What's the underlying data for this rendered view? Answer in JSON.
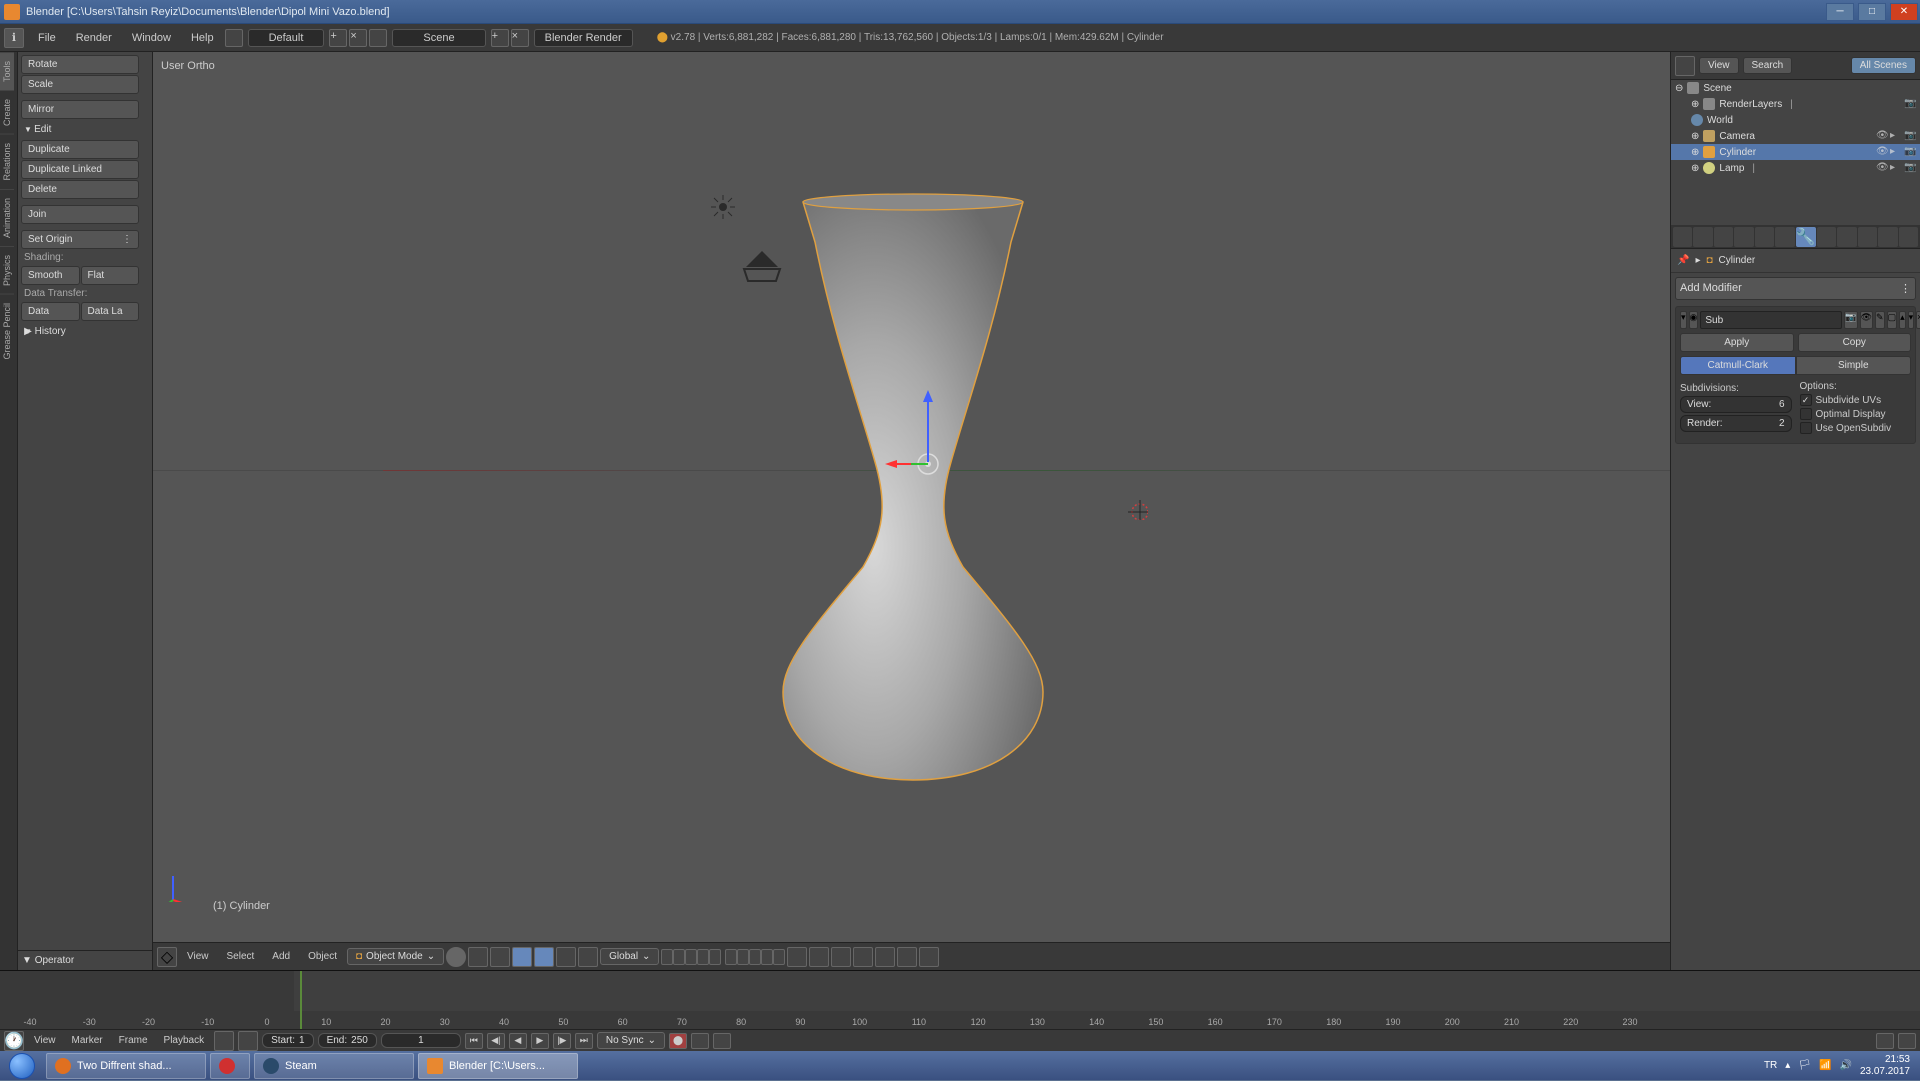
{
  "window": {
    "title": "Blender [C:\\Users\\Tahsin Reyiz\\Documents\\Blender\\Dipol Mini Vazo.blend]"
  },
  "info_header": {
    "menus": [
      "File",
      "Render",
      "Window",
      "Help"
    ],
    "layout": "Default",
    "scene": "Scene",
    "engine": "Blender Render",
    "stats": "v2.78 | Verts:6,881,282 | Faces:6,881,280 | Tris:13,762,560 | Objects:1/3 | Lamps:0/1 | Mem:429.62M | Cylinder"
  },
  "tool_tabs": [
    "Tools",
    "Create",
    "Relations",
    "Animation",
    "Physics",
    "Grease Pencil"
  ],
  "tool_panel": {
    "rotate": "Rotate",
    "scale": "Scale",
    "mirror": "Mirror",
    "edit_header": "Edit",
    "duplicate": "Duplicate",
    "duplicate_linked": "Duplicate Linked",
    "delete": "Delete",
    "join": "Join",
    "set_origin": "Set Origin",
    "shading_label": "Shading:",
    "smooth": "Smooth",
    "flat": "Flat",
    "data_transfer_label": "Data Transfer:",
    "data": "Data",
    "data_la": "Data La",
    "history_header": "History"
  },
  "operator": "Operator",
  "viewport": {
    "view_label": "User Ortho",
    "object_label": "(1) Cylinder",
    "menus": [
      "View",
      "Select",
      "Add",
      "Object"
    ],
    "mode": "Object Mode",
    "orient": "Global"
  },
  "outliner": {
    "tabs": {
      "view": "View",
      "search": "Search",
      "all_scenes": "All Scenes"
    },
    "scene": "Scene",
    "render_layers": "RenderLayers",
    "world": "World",
    "camera": "Camera",
    "cylinder": "Cylinder",
    "lamp": "Lamp"
  },
  "properties": {
    "breadcrumb_obj": "Cylinder",
    "add_modifier": "Add Modifier",
    "modifier": {
      "name": "Sub",
      "apply": "Apply",
      "copy": "Copy",
      "type_catmull": "Catmull-Clark",
      "type_simple": "Simple",
      "subdivisions_label": "Subdivisions:",
      "view_label": "View:",
      "view_value": "6",
      "render_label": "Render:",
      "render_value": "2",
      "options_label": "Options:",
      "subdivide_uvs": "Subdivide UVs",
      "optimal_display": "Optimal Display",
      "use_opensubdiv": "Use OpenSubdiv"
    }
  },
  "timeline": {
    "menus": [
      "View",
      "Marker",
      "Frame",
      "Playback"
    ],
    "start_label": "Start:",
    "start_value": "1",
    "end_label": "End:",
    "end_value": "250",
    "current": "1",
    "sync": "No Sync",
    "ticks": [
      "-40",
      "-30",
      "-20",
      "-10",
      "0",
      "10",
      "20",
      "30",
      "40",
      "50",
      "60",
      "70",
      "80",
      "90",
      "100",
      "110",
      "120",
      "130",
      "140",
      "150",
      "160",
      "170",
      "180",
      "190",
      "200",
      "210",
      "220",
      "230"
    ]
  },
  "taskbar": {
    "items": [
      {
        "label": "Two Diffrent shad...",
        "color": "#e07020"
      },
      {
        "label": "",
        "color": "#d03030"
      },
      {
        "label": "Steam",
        "color": "#2a4a6a"
      },
      {
        "label": "Blender [C:\\Users...",
        "color": "#e88830"
      }
    ],
    "lang": "TR",
    "time": "21:53",
    "date": "23.07.2017"
  }
}
